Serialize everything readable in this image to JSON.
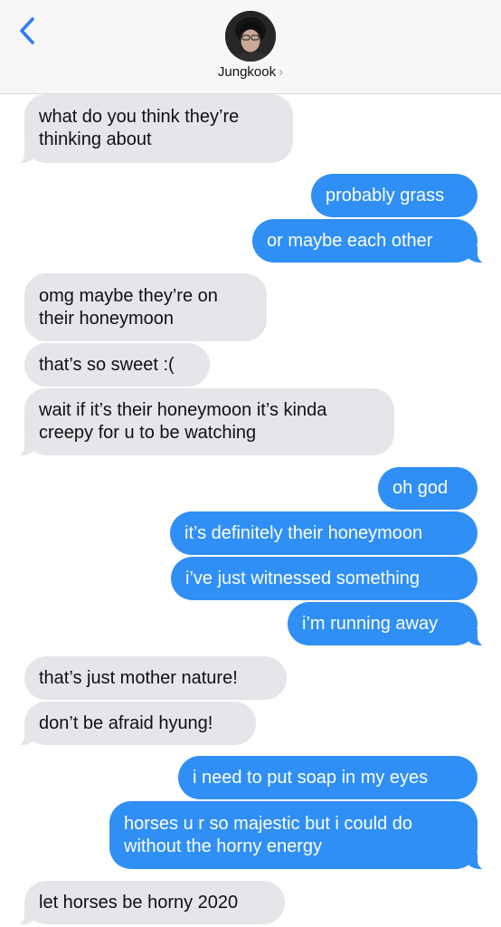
{
  "header": {
    "contact_name": "Jungkook",
    "chevron": "›",
    "back_icon": "chevron-left-icon",
    "avatar_icon": "contact-avatar"
  },
  "colors": {
    "incoming_bubble": "#e5e5ea",
    "outgoing_bubble": "#2f8ff5",
    "accent": "#2f7cf6"
  },
  "messages": [
    {
      "from": "contact",
      "text": "what do you think they’re\nthinking about"
    },
    {
      "from": "me",
      "text": "probably grass"
    },
    {
      "from": "me",
      "text": "or maybe each other"
    },
    {
      "from": "contact",
      "text": "omg maybe they’re on\ntheir honeymoon"
    },
    {
      "from": "contact",
      "text": "that’s so sweet :("
    },
    {
      "from": "contact",
      "text": "wait if it’s their honeymoon it’s kinda\ncreepy for u to be watching"
    },
    {
      "from": "me",
      "text": "oh god"
    },
    {
      "from": "me",
      "text": "it’s definitely their honeymoon"
    },
    {
      "from": "me",
      "text": "i’ve just witnessed something"
    },
    {
      "from": "me",
      "text": "i’m running away"
    },
    {
      "from": "contact",
      "text": "that’s just mother nature!"
    },
    {
      "from": "contact",
      "text": "don’t be afraid hyung!"
    },
    {
      "from": "me",
      "text": "i need to put soap in my eyes"
    },
    {
      "from": "me",
      "text": "horses u r so majestic but i could do\nwithout the horny energy"
    },
    {
      "from": "contact",
      "text": "let horses be horny 2020"
    }
  ]
}
